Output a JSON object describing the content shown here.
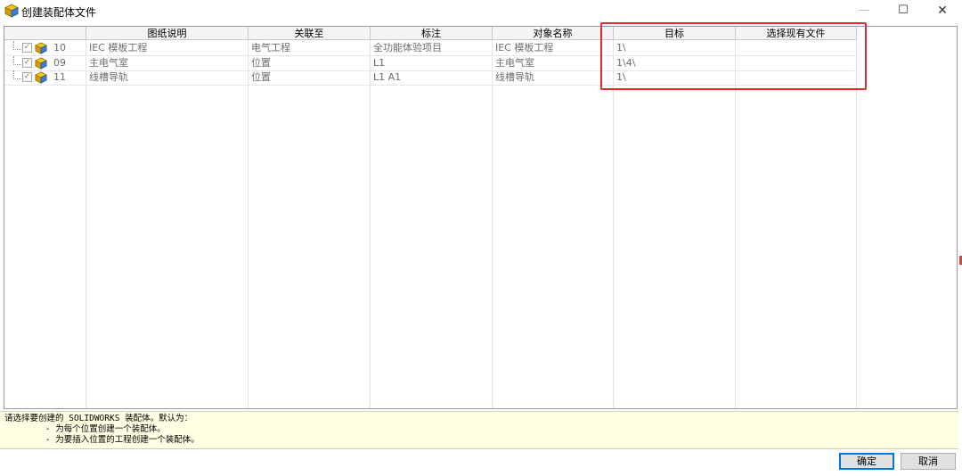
{
  "window": {
    "title": "创建装配体文件",
    "minimize_symbol": "—",
    "maximize_symbol": "☐",
    "close_symbol": "✕",
    "app_icon": "assembly-icon"
  },
  "grid": {
    "columns": [
      "图纸说明",
      "关联至",
      "标注",
      "对象名称",
      "目标",
      "选择现有文件"
    ],
    "rows": [
      {
        "num": "10",
        "checked": true,
        "desc": "IEC 模板工程",
        "link": "电气工程",
        "mark": "全功能体验项目",
        "obj": "IEC 模板工程",
        "target": "1\\",
        "existing": ""
      },
      {
        "num": "09",
        "checked": true,
        "desc": "主电气室",
        "link": "位置",
        "mark": "L1",
        "obj": "主电气室",
        "target": "1\\4\\",
        "existing": ""
      },
      {
        "num": "11",
        "checked": true,
        "desc": "线槽导轨",
        "link": "位置",
        "mark": "L1 A1",
        "obj": "线槽导轨",
        "target": "1\\",
        "existing": ""
      }
    ]
  },
  "info": {
    "lines": [
      "请选择要创建的 SOLIDWORKS 装配体。默认为：",
      "        - 为每个位置创建一个装配体。",
      "        - 为要插入位置的工程创建一个装配体。"
    ]
  },
  "buttons": {
    "ok": "确定",
    "cancel": "取消"
  },
  "colors": {
    "highlight": "#e8262d",
    "info_bg": "#ffffe4",
    "ok_border": "#0078d7"
  }
}
